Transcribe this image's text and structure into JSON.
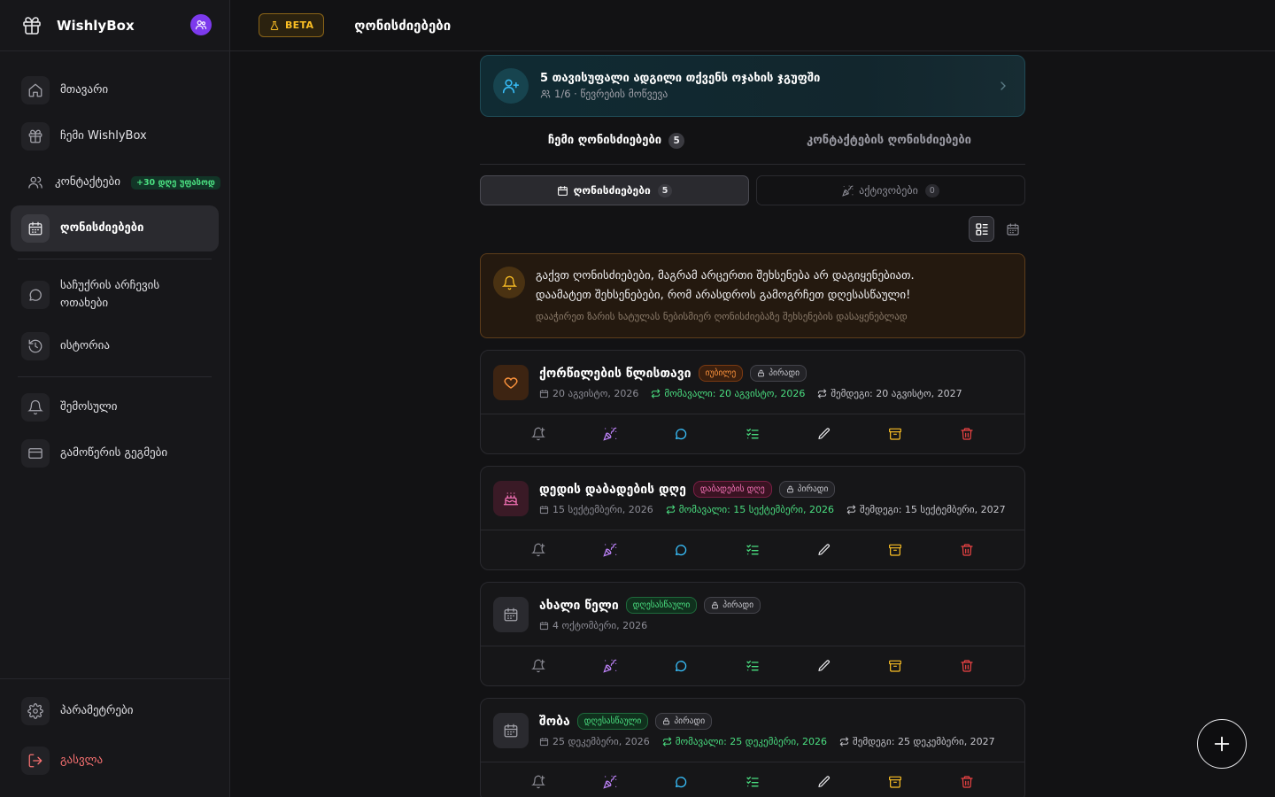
{
  "brand": {
    "name": "WishlyBox"
  },
  "header": {
    "beta": "BETA",
    "title": "ღონისძიებები"
  },
  "sidebar": {
    "items": [
      {
        "label": "მთავარი"
      },
      {
        "label": "ჩემი WishlyBox"
      },
      {
        "label": "კონტაქტები",
        "badge": "+30 დღე უფასოდ"
      },
      {
        "label": "ღონისძიებები"
      },
      {
        "label": "საჩუქრის არჩევის ოთახები"
      },
      {
        "label": "ისტორია"
      },
      {
        "label": "შემოსული"
      },
      {
        "label": "გამოწერის გეგმები"
      }
    ],
    "bottom": [
      {
        "label": "პარამეტრები"
      },
      {
        "label": "გასვლა"
      }
    ]
  },
  "promo": {
    "title": "5 თავისუფალი ადგილი თქვენს ოჯახის ჯგუფში",
    "subtitle": "1/6 · წევრების მოწვევა"
  },
  "tabs": [
    {
      "label": "ჩემი ღონისძიებები",
      "count": "5"
    },
    {
      "label": "კონტაქტების ღონისძიებები"
    }
  ],
  "subtabs": [
    {
      "label": "ღონისძიებები",
      "count": "5"
    },
    {
      "label": "აქტივობები",
      "count": "0"
    }
  ],
  "alert": {
    "line1": "გაქვთ ღონისძიებები, მაგრამ არცერთი შეხსენება არ დაგიყენებიათ.",
    "line2": "დაამატეთ შეხსენებები, რომ არასდროს გამოგრჩეთ დღესასწაული!",
    "hint": "დააჭირეთ ზარის ხატულას ნებისმიერ ღონისძიებაზე შეხსენების დასაყენებლად"
  },
  "events": [
    {
      "title": "ქორწილების წლისთავი",
      "tag": "იუბილე",
      "privacy": "პირადი",
      "date": "20 აგვისტო, 2026",
      "recur": "მომავალი: 20 აგვისტო, 2026",
      "next": "შემდეგი: 20 აგვისტო, 2027"
    },
    {
      "title": "დედის დაბადების დღე",
      "tag": "დაბადების დღე",
      "privacy": "პირადი",
      "date": "15 სექტემბერი, 2026",
      "recur": "მომავალი: 15 სექტემბერი, 2026",
      "next": "შემდეგი: 15 სექტემბერი, 2027"
    },
    {
      "title": "ახალი წელი",
      "tag": "დღესასწაული",
      "privacy": "პირადი",
      "date": "4 ოქტომბერი, 2026"
    },
    {
      "title": "შობა",
      "tag": "დღესასწაული",
      "privacy": "პირადი",
      "date": "25 დეკემბერი, 2026",
      "recur": "მომავალი: 25 დეკემბერი, 2026",
      "next": "შემდეგი: 25 დეკემბერი, 2027"
    }
  ],
  "colors": {
    "accent_purple": "#7c3aed",
    "warning": "#fbbf24",
    "success": "#4ade80",
    "danger": "#ef4444",
    "info": "#38bdf8"
  }
}
